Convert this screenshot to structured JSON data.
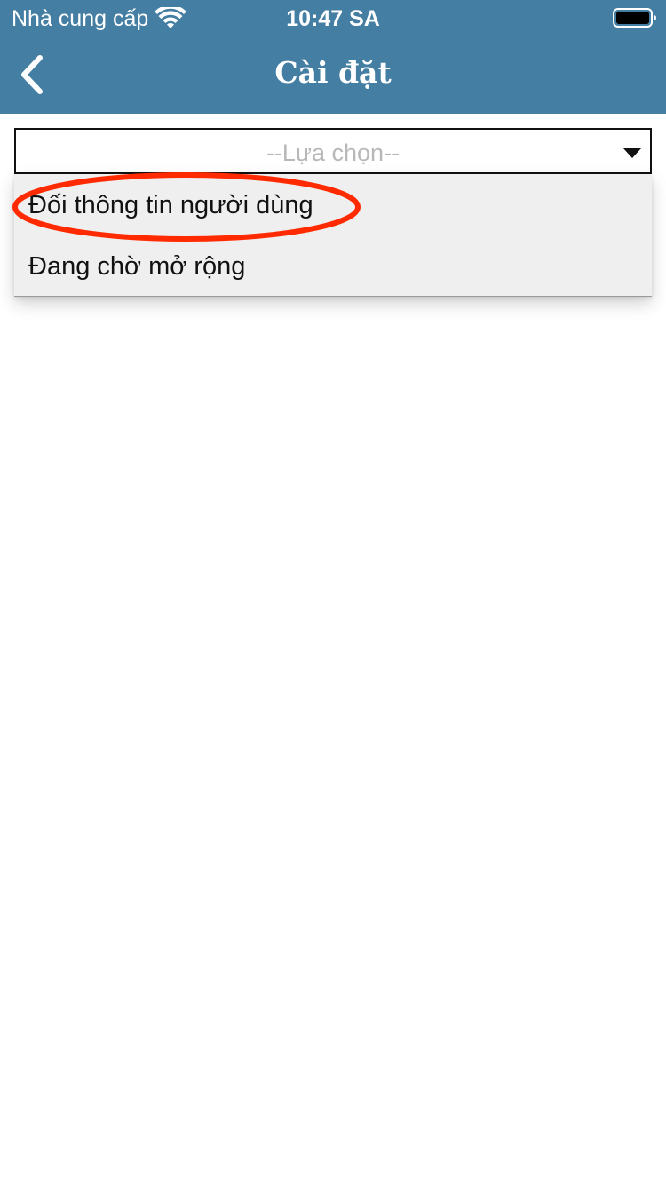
{
  "status_bar": {
    "carrier": "Nhà cung cấp",
    "time": "10:47 SA",
    "wifi_icon": "wifi-icon",
    "battery_icon": "battery-icon"
  },
  "nav": {
    "title": "Cài đặt",
    "back_icon": "chevron-left-icon"
  },
  "select": {
    "placeholder": "--Lựa chọn--",
    "arrow_icon": "caret-down-icon"
  },
  "menu": {
    "items": [
      {
        "label": "Đối thông tin người dùng",
        "highlighted": true
      },
      {
        "label": "Đang chờ mở rộng",
        "highlighted": false
      }
    ]
  },
  "colors": {
    "header": "#447ea3",
    "header_text": "#ffffff",
    "menu_background": "#efefef",
    "highlight": "#ff2a00",
    "placeholder": "#b8b8b8"
  }
}
